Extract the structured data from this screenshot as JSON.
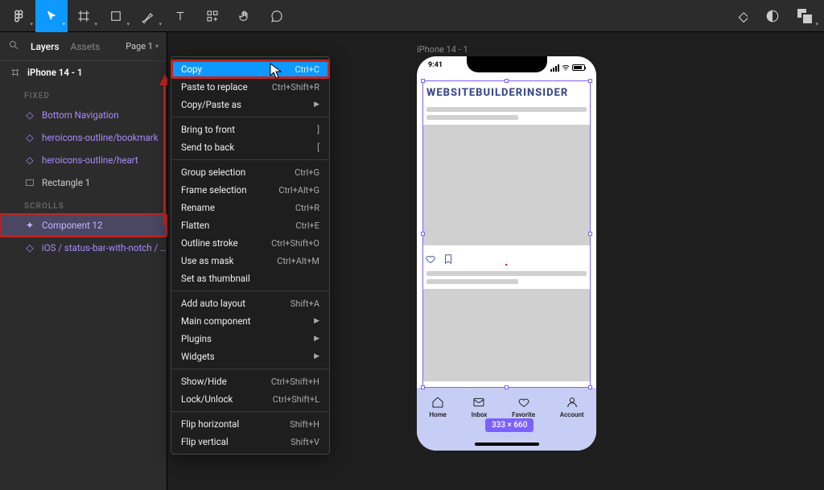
{
  "toolbar": {
    "figma": "F"
  },
  "panel": {
    "layers_tab": "Layers",
    "assets_tab": "Assets",
    "page_label": "Page 1",
    "frame_name": "iPhone 14 - 1",
    "fixed_label": "FIXED",
    "scrolls_label": "SCROLLS",
    "layers": {
      "bottom_nav": "Bottom Navigation",
      "bookmark": "heroicons-outline/bookmark",
      "heart": "heroicons-outline/heart",
      "rect": "Rectangle 1",
      "component12": "Component 12",
      "statusbar": "iOS / status-bar-with-notch / ..."
    }
  },
  "menu": {
    "copy": "Copy",
    "copy_k": "Ctrl+C",
    "paste_replace": "Paste to replace",
    "paste_replace_k": "Ctrl+Shift+R",
    "copy_paste_as": "Copy/Paste as",
    "bring_front": "Bring to front",
    "bring_front_k": "]",
    "send_back": "Send to back",
    "send_back_k": "[",
    "group": "Group selection",
    "group_k": "Ctrl+G",
    "frame": "Frame selection",
    "frame_k": "Ctrl+Alt+G",
    "rename": "Rename",
    "rename_k": "Ctrl+R",
    "flatten": "Flatten",
    "flatten_k": "Ctrl+E",
    "outline": "Outline stroke",
    "outline_k": "Ctrl+Shift+O",
    "mask": "Use as mask",
    "mask_k": "Ctrl+Alt+M",
    "thumb": "Set as thumbnail",
    "autolayout": "Add auto layout",
    "autolayout_k": "Shift+A",
    "main_comp": "Main component",
    "plugins": "Plugins",
    "widgets": "Widgets",
    "showhide": "Show/Hide",
    "showhide_k": "Ctrl+Shift+H",
    "lock": "Lock/Unlock",
    "lock_k": "Ctrl+Shift+L",
    "fliph": "Flip horizontal",
    "fliph_k": "Shift+H",
    "flipv": "Flip vertical",
    "flipv_k": "Shift+V"
  },
  "canvas": {
    "frame_label": "iPhone 14 - 1",
    "time": "9:41",
    "title": "WEBSITEBUILDERINSIDER",
    "nav": {
      "home": "Home",
      "inbox": "Inbox",
      "favorite": "Favorite",
      "account": "Account"
    },
    "dim_badge": "333 × 660"
  }
}
